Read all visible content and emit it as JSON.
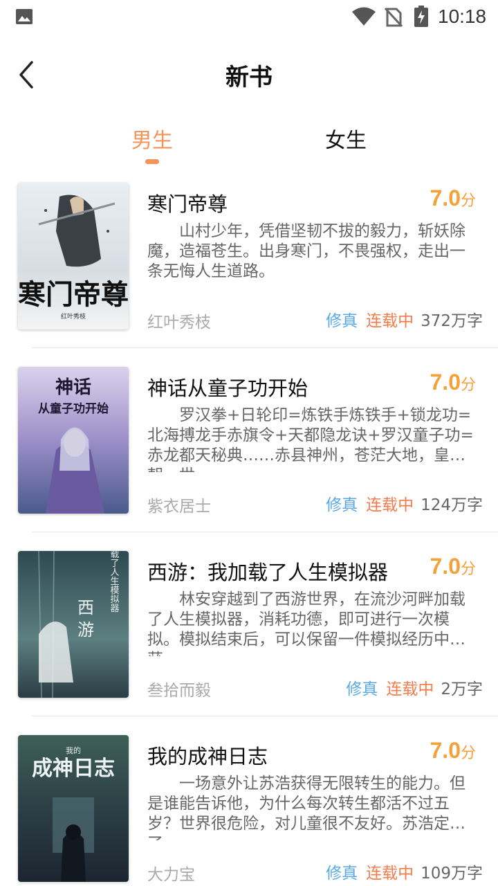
{
  "status_bar": {
    "time": "10:18"
  },
  "header": {
    "title": "新书"
  },
  "tabs": [
    {
      "label": "男生",
      "active": true
    },
    {
      "label": "女生",
      "active": false
    }
  ],
  "colors": {
    "accent": "#f5935a",
    "score": "#f5a13a",
    "genre": "#5aa9e6",
    "state": "#f57c4a"
  },
  "books": [
    {
      "title": "寒门帝尊",
      "score": "7.0",
      "score_unit": "分",
      "description": "山村少年，凭借坚韧不拔的毅力，斩妖除魔，造福苍生。出身寒门，不畏强权，走出一条无悔人生道路。",
      "author": "红叶秀枝",
      "genre": "修真",
      "state": "连载中",
      "words": "372万字",
      "cover_text": "寒门帝尊"
    },
    {
      "title": "神话从童子功开始",
      "score": "7.0",
      "score_unit": "分",
      "description": "罗汉拳+日轮印=炼铁手炼铁手+锁龙功=北海搏龙手赤旗令+天都隐龙诀+罗汉童子功=赤龙都天秘典……赤县神州，苍茫大地，皇朝，世…",
      "author": "紫衣居士",
      "genre": "修真",
      "state": "连载中",
      "words": "124万字",
      "cover_text": "神话从童子功开始"
    },
    {
      "title": "西游：我加载了人生模拟器",
      "score": "7.0",
      "score_unit": "分",
      "description": "林安穿越到了西游世界，在流沙河畔加载了人生模拟器，消耗功德，即可进行一次模拟。模拟结束后，可以保留一件模拟经历中收获…",
      "author": "叁拾而毅",
      "genre": "修真",
      "state": "连载中",
      "words": "2万字",
      "cover_text": "西游"
    },
    {
      "title": "我的成神日志",
      "score": "7.0",
      "score_unit": "分",
      "description": "一场意外让苏浩获得无限转生的能力。但是谁能告诉他，为什么每次转生都活不过五岁？世界很危险，对儿童很不友好。苏浩定下了…",
      "author": "大力宝",
      "genre": "修真",
      "state": "连载中",
      "words": "109万字",
      "cover_text": "成神日志"
    }
  ]
}
